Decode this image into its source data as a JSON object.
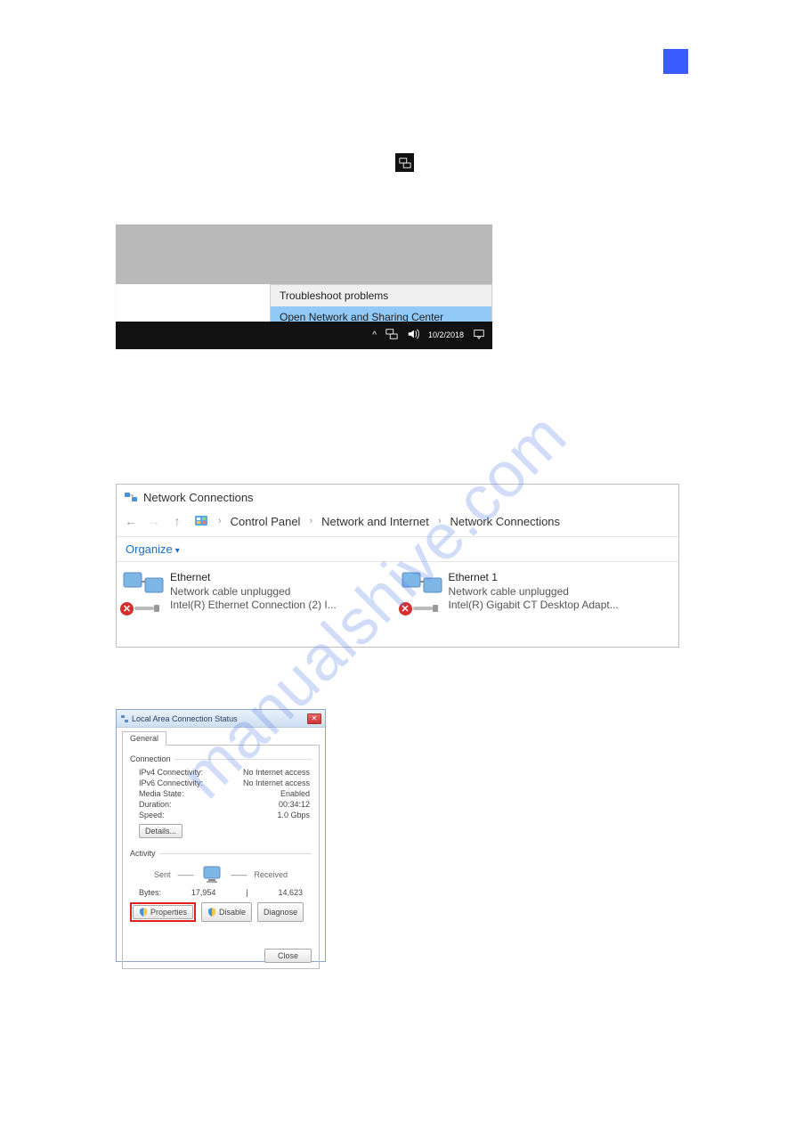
{
  "watermark": "manualshive.com",
  "tray_menu": {
    "item1": "Troubleshoot problems",
    "item2": "Open Network and Sharing Center",
    "date": "10/2/2018"
  },
  "netconn": {
    "title": "Network Connections",
    "crumb1": "Control Panel",
    "crumb2": "Network and Internet",
    "crumb3": "Network Connections",
    "organize": "Organize",
    "adapter1": {
      "name": "Ethernet",
      "status": "Network cable unplugged",
      "device": "Intel(R) Ethernet Connection (2) I..."
    },
    "adapter2": {
      "name": "Ethernet 1",
      "status": "Network cable unplugged",
      "device": "Intel(R) Gigabit CT Desktop Adapt..."
    }
  },
  "status": {
    "title": "Local Area Connection Status",
    "tab": "General",
    "grp1": "Connection",
    "ipv4_l": "IPv4 Connectivity:",
    "ipv4_v": "No Internet access",
    "ipv6_l": "IPv6 Connectivity:",
    "ipv6_v": "No Internet access",
    "media_l": "Media State:",
    "media_v": "Enabled",
    "dur_l": "Duration:",
    "dur_v": "00:34:12",
    "speed_l": "Speed:",
    "speed_v": "1.0 Gbps",
    "details": "Details...",
    "grp2": "Activity",
    "sent": "Sent",
    "received": "Received",
    "bytes_l": "Bytes:",
    "bytes_sent": "17,954",
    "bytes_recv": "14,623",
    "properties": "Properties",
    "disable": "Disable",
    "diagnose": "Diagnose",
    "close": "Close"
  }
}
